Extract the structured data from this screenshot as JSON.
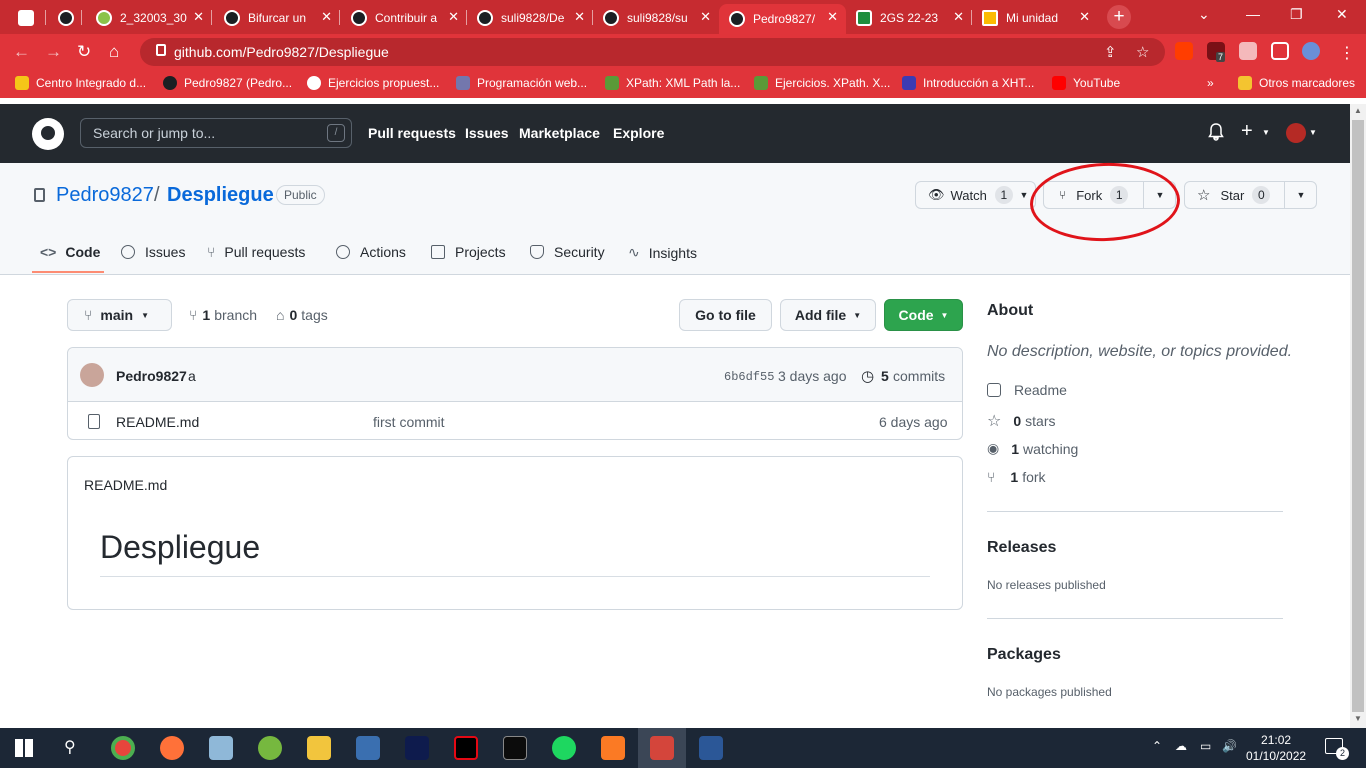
{
  "browser": {
    "tabs": [
      {
        "title": "",
        "active": false
      },
      {
        "title": "",
        "active": false
      },
      {
        "title": "2_32003_30",
        "active": false
      },
      {
        "title": "Bifurcar un",
        "active": false
      },
      {
        "title": "Contribuir a",
        "active": false
      },
      {
        "title": "suli9828/De",
        "active": false
      },
      {
        "title": "suli9828/su",
        "active": false
      },
      {
        "title": "Pedro9827/",
        "active": true
      },
      {
        "title": "2GS 22-23",
        "active": false
      },
      {
        "title": "Mi unidad",
        "active": false
      }
    ],
    "url": "github.com/Pedro9827/Despliegue",
    "bookmarks": [
      "Centro Integrado d...",
      "Pedro9827 (Pedro...",
      "Ejercicios propuest...",
      "Programación web...",
      "XPath: XML Path la...",
      "Ejercicios. XPath. X...",
      "Introducción a XHT...",
      "YouTube"
    ],
    "bookmarks_more": "»",
    "other_bookmarks": "Otros marcadores",
    "extension_badge": "7"
  },
  "github": {
    "search_placeholder": "Search or jump to...",
    "search_shortcut": "/",
    "nav": [
      "Pull requests",
      "Issues",
      "Marketplace",
      "Explore"
    ],
    "plus": "+"
  },
  "repo": {
    "owner": "Pedro9827",
    "separator": "/",
    "name": "Despliegue",
    "visibility": "Public",
    "watch_label": "Watch",
    "watch_count": "1",
    "fork_label": "Fork",
    "fork_count": "1",
    "star_label": "Star",
    "star_count": "0",
    "tabs": [
      "Code",
      "Issues",
      "Pull requests",
      "Actions",
      "Projects",
      "Security",
      "Insights"
    ]
  },
  "toolbar": {
    "branch": "main",
    "branches_count": "1",
    "branches_label": "branch",
    "tags_count": "0",
    "tags_label": "tags",
    "go_to_file": "Go to file",
    "add_file": "Add file",
    "code": "Code"
  },
  "commit": {
    "author": "Pedro9827",
    "message": "a",
    "hash": "6b6df55",
    "time": "3 days ago",
    "commits_count": "5",
    "commits_label": "commits"
  },
  "files": [
    {
      "name": "README.md",
      "message": "first commit",
      "time": "6 days ago"
    }
  ],
  "readme": {
    "filename": "README.md",
    "heading": "Despliegue"
  },
  "about": {
    "title": "About",
    "description": "No description, website, or topics provided.",
    "readme": "Readme",
    "stars_count": "0",
    "stars_label": "stars",
    "watching_count": "1",
    "watching_label": "watching",
    "forks_count": "1",
    "forks_label": "fork",
    "releases_title": "Releases",
    "releases_text": "No releases published",
    "packages_title": "Packages",
    "packages_text": "No packages published"
  },
  "taskbar": {
    "time": "21:02",
    "date": "01/10/2022",
    "notifications": "2"
  },
  "colors": {
    "browser_chrome": "#e0343a",
    "github_header": "#24292f",
    "link": "#0969da",
    "code_button": "#2da44e",
    "annotation_circle": "#e0141a"
  }
}
